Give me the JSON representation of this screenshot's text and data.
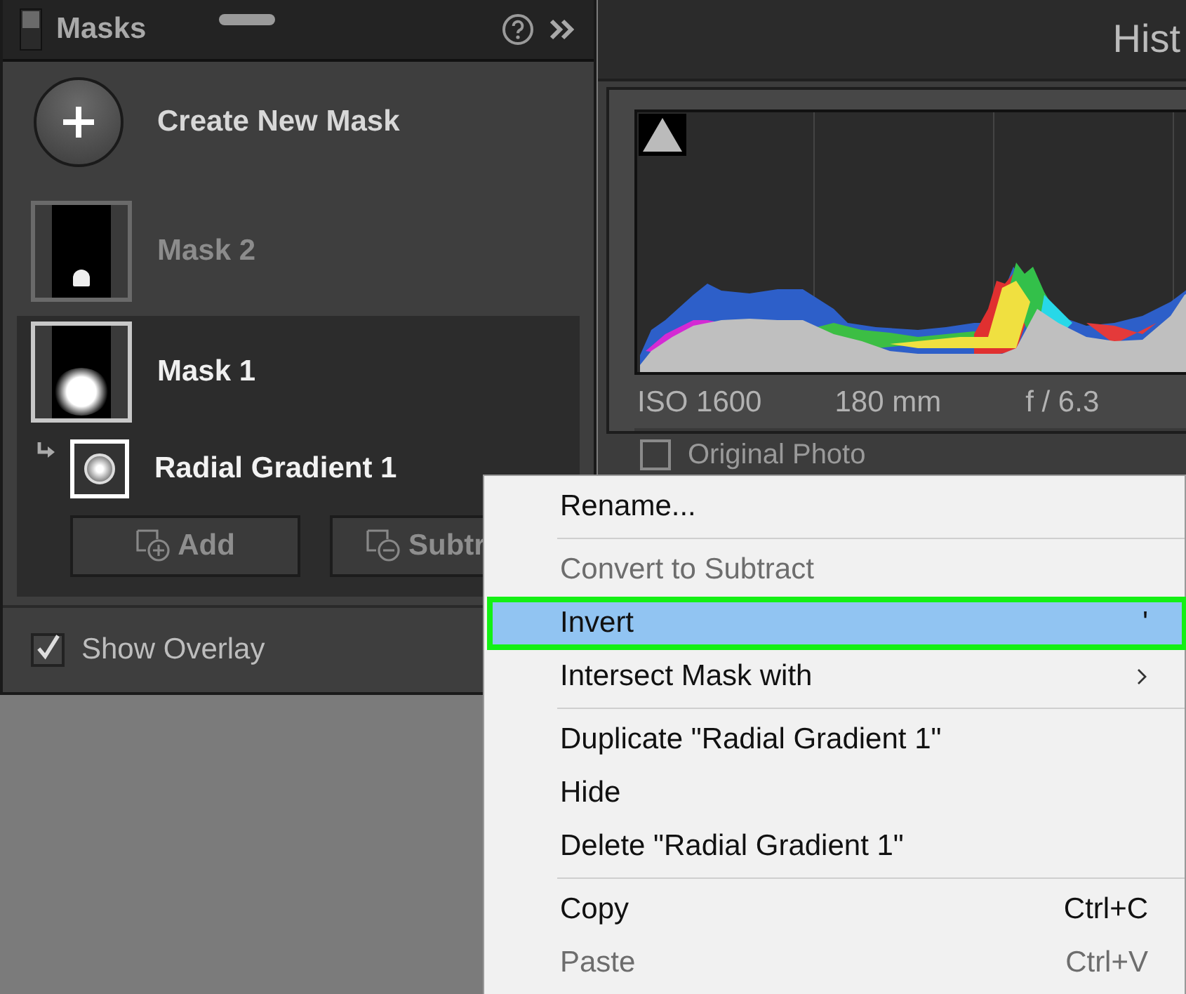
{
  "masks_panel": {
    "title": "Masks",
    "create_label": "Create New Mask",
    "masks": [
      {
        "name": "Mask 2",
        "selected": false
      },
      {
        "name": "Mask 1",
        "selected": true,
        "components": [
          {
            "name": "Radial Gradient 1",
            "selected": true
          }
        ]
      }
    ],
    "buttons": [
      {
        "label": "Add",
        "kind": "add"
      },
      {
        "label": "Subtr",
        "kind": "subtract"
      }
    ],
    "show_overlay": {
      "label": "Show Overlay",
      "checked": true
    }
  },
  "histogram_panel": {
    "title": "Hist",
    "metadata": [
      "ISO 1600",
      "180 mm",
      "f / 6.3"
    ],
    "original_photo": {
      "label": "Original Photo",
      "checked": false
    }
  },
  "context_menu": {
    "items": [
      {
        "kind": "item",
        "label": "Rename...",
        "disabled": false,
        "selected": false
      },
      {
        "kind": "separator"
      },
      {
        "kind": "item",
        "label": "Convert to Subtract",
        "disabled": true,
        "selected": false
      },
      {
        "kind": "item",
        "label": "Invert",
        "shortcut": "'",
        "disabled": false,
        "selected": true
      },
      {
        "kind": "submenu",
        "label": "Intersect Mask with",
        "disabled": false,
        "selected": false
      },
      {
        "kind": "separator"
      },
      {
        "kind": "item",
        "label": "Duplicate \"Radial Gradient 1\"",
        "disabled": false,
        "selected": false
      },
      {
        "kind": "item",
        "label": "Hide",
        "disabled": false,
        "selected": false
      },
      {
        "kind": "item",
        "label": "Delete \"Radial Gradient 1\"",
        "disabled": false,
        "selected": false
      },
      {
        "kind": "separator"
      },
      {
        "kind": "item",
        "label": "Copy",
        "shortcut": "Ctrl+C",
        "disabled": false,
        "selected": false
      },
      {
        "kind": "item",
        "label": "Paste",
        "shortcut": "Ctrl+V",
        "disabled": true,
        "selected": false
      }
    ]
  }
}
